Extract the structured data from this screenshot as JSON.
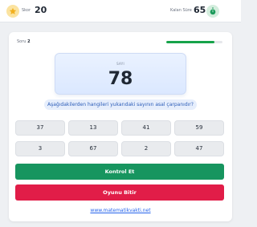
{
  "header": {
    "score_label": "Skor",
    "score_value": "20",
    "time_label": "Kalan Süre",
    "time_value": "65"
  },
  "question": {
    "label_prefix": "Soru",
    "number": "2",
    "progress": 0.86,
    "number_label": "SAYI",
    "number_value": "78",
    "prompt": "Aşağıdakilerden hangileri yukarıdaki sayının asal çarpanıdır?"
  },
  "options": [
    "37",
    "13",
    "41",
    "59",
    "3",
    "67",
    "2",
    "47"
  ],
  "buttons": {
    "check": "Kontrol Et",
    "end": "Oyunu Bitir"
  },
  "footer": {
    "link": "www.matematikvakti.net"
  },
  "colors": {
    "accent_green": "#17955f",
    "danger_red": "#e11d48",
    "link_blue": "#2563eb",
    "star": "#f2b01e"
  },
  "icons": {
    "score": "star-icon",
    "time": "stopwatch-icon"
  }
}
